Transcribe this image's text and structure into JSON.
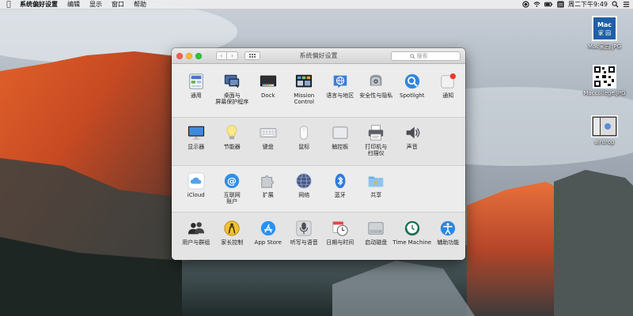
{
  "menubar": {
    "apple_icon": "apple-logo-icon",
    "app_name": "系统偏好设置",
    "menus": [
      "编辑",
      "显示",
      "窗口",
      "帮助"
    ],
    "clock": "周二下午9:49",
    "status_icons": [
      "record-icon",
      "wifi-icon",
      "battery-icon",
      "input-source-icon",
      "spotlight-icon",
      "list-icon"
    ]
  },
  "desktop": {
    "items": [
      {
        "caption": "Mac家园.JPG",
        "icon": "mac-logo-image",
        "logo_text": "Mac\n家 园"
      },
      {
        "caption": "Maccollege.JPG",
        "icon": "qr-code-image"
      },
      {
        "caption": "airdrop",
        "icon": "screenshot-image"
      }
    ]
  },
  "window": {
    "title": "系统偏好设置",
    "search_placeholder": "搜索",
    "sections": [
      [
        {
          "label": "通用",
          "icon": "general-icon"
        },
        {
          "label": "桌面与\n屏幕保护程序",
          "icon": "desktop-screensaver-icon"
        },
        {
          "label": "Dock",
          "icon": "dock-icon"
        },
        {
          "label": "Mission\nControl",
          "icon": "mission-control-icon"
        },
        {
          "label": "语言与地区",
          "icon": "language-region-icon"
        },
        {
          "label": "安全性与隐私",
          "icon": "security-privacy-icon"
        },
        {
          "label": "Spotlight",
          "icon": "spotlight-icon"
        },
        {
          "label": "通知",
          "icon": "notifications-icon"
        }
      ],
      [
        {
          "label": "显示器",
          "icon": "displays-icon"
        },
        {
          "label": "节能器",
          "icon": "energy-saver-icon"
        },
        {
          "label": "键盘",
          "icon": "keyboard-icon"
        },
        {
          "label": "鼠标",
          "icon": "mouse-icon"
        },
        {
          "label": "触控板",
          "icon": "trackpad-icon"
        },
        {
          "label": "打印机与\n扫描仪",
          "icon": "printers-scanners-icon"
        },
        {
          "label": "声音",
          "icon": "sound-icon"
        }
      ],
      [
        {
          "label": "iCloud",
          "icon": "icloud-icon"
        },
        {
          "label": "互联网\n账户",
          "icon": "internet-accounts-icon"
        },
        {
          "label": "扩展",
          "icon": "extensions-icon"
        },
        {
          "label": "网络",
          "icon": "network-icon"
        },
        {
          "label": "蓝牙",
          "icon": "bluetooth-icon"
        },
        {
          "label": "共享",
          "icon": "sharing-icon"
        }
      ],
      [
        {
          "label": "用户与群组",
          "icon": "users-groups-icon"
        },
        {
          "label": "家长控制",
          "icon": "parental-controls-icon"
        },
        {
          "label": "App Store",
          "icon": "app-store-icon"
        },
        {
          "label": "听写与语音",
          "icon": "dictation-speech-icon"
        },
        {
          "label": "日期与时间",
          "icon": "date-time-icon"
        },
        {
          "label": "启动磁盘",
          "icon": "startup-disk-icon"
        },
        {
          "label": "Time Machine",
          "icon": "time-machine-icon"
        },
        {
          "label": "辅助功能",
          "icon": "accessibility-icon"
        }
      ]
    ]
  }
}
